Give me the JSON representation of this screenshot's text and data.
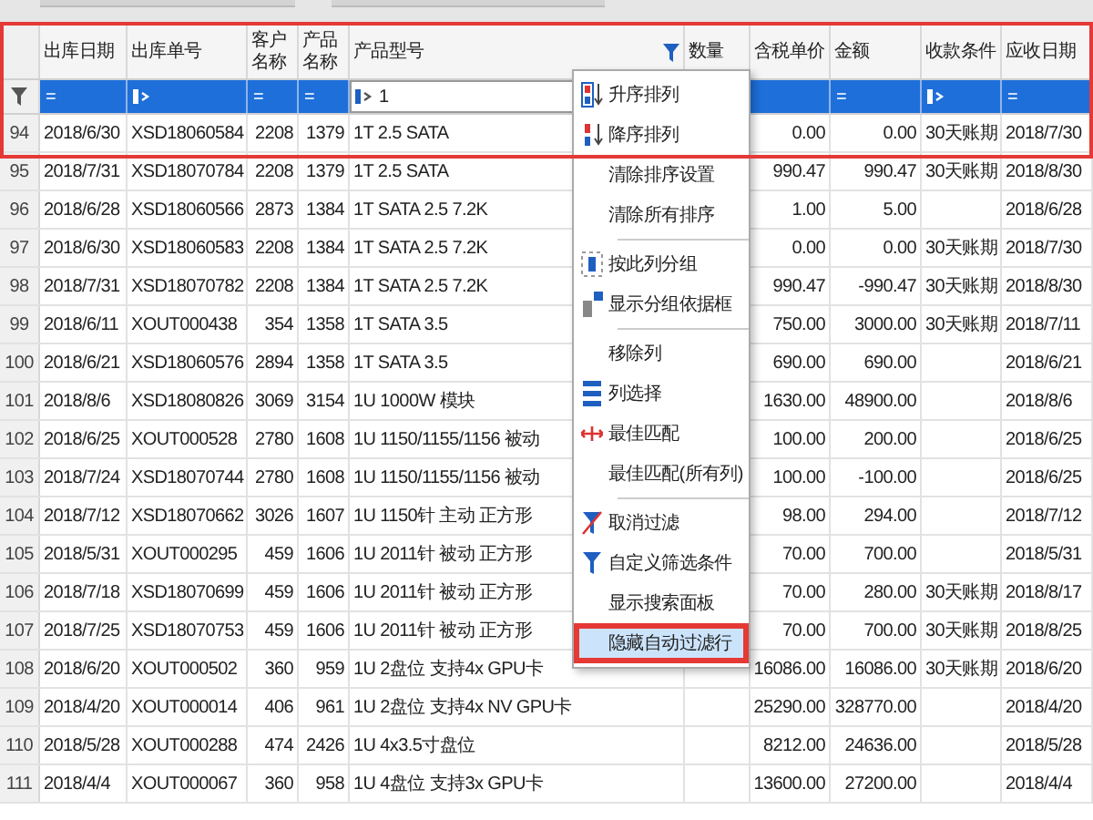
{
  "table": {
    "columns": [
      {
        "label": "出库日期"
      },
      {
        "label": "出库单号"
      },
      {
        "label": "客户名称"
      },
      {
        "label": "产品名称"
      },
      {
        "label": "产品型号",
        "filtered": true
      },
      {
        "label": "数量"
      },
      {
        "label": "含税单价"
      },
      {
        "label": "金额"
      },
      {
        "label": "收款条件"
      },
      {
        "label": "应收日期"
      }
    ],
    "filters": [
      {
        "kind": "equals",
        "text": "="
      },
      {
        "kind": "contains"
      },
      {
        "kind": "equals",
        "text": "="
      },
      {
        "kind": "equals",
        "text": "="
      },
      {
        "kind": "value",
        "value": "1"
      },
      {
        "kind": "blank"
      },
      {
        "kind": "blank"
      },
      {
        "kind": "equals",
        "text": "="
      },
      {
        "kind": "contains"
      },
      {
        "kind": "equals",
        "text": "="
      }
    ],
    "rows": [
      {
        "num": "94",
        "date": "2018/6/30",
        "order": "XSD18060584",
        "customer": "2208",
        "product": "1379",
        "model": "1T 2.5 SATA",
        "unit_price": "0.00",
        "amount": "0.00",
        "terms": "30天账期",
        "due": "2018/7/30"
      },
      {
        "num": "95",
        "date": "2018/7/31",
        "order": "XSD18070784",
        "customer": "2208",
        "product": "1379",
        "model": "1T 2.5 SATA",
        "unit_price": "990.47",
        "amount": "990.47",
        "terms": "30天账期",
        "due": "2018/8/30"
      },
      {
        "num": "96",
        "date": "2018/6/28",
        "order": "XSD18060566",
        "customer": "2873",
        "product": "1384",
        "model": "1T SATA 2.5 7.2K",
        "unit_price": "1.00",
        "amount": "5.00",
        "due": "2018/6/28"
      },
      {
        "num": "97",
        "date": "2018/6/30",
        "order": "XSD18060583",
        "customer": "2208",
        "product": "1384",
        "model": "1T SATA 2.5 7.2K",
        "unit_price": "0.00",
        "amount": "0.00",
        "terms": "30天账期",
        "due": "2018/7/30"
      },
      {
        "num": "98",
        "date": "2018/7/31",
        "order": "XSD18070782",
        "customer": "2208",
        "product": "1384",
        "model": "1T SATA 2.5 7.2K",
        "unit_price": "990.47",
        "amount": "-990.47",
        "terms": "30天账期",
        "due": "2018/8/30"
      },
      {
        "num": "99",
        "date": "2018/6/11",
        "order": "XOUT000438",
        "customer": "354",
        "product": "1358",
        "model": "1T SATA 3.5",
        "unit_price": "750.00",
        "amount": "3000.00",
        "terms": "30天账期",
        "due": "2018/7/11"
      },
      {
        "num": "100",
        "date": "2018/6/21",
        "order": "XSD18060576",
        "customer": "2894",
        "product": "1358",
        "model": "1T SATA 3.5",
        "unit_price": "690.00",
        "amount": "690.00",
        "due": "2018/6/21"
      },
      {
        "num": "101",
        "date": "2018/8/6",
        "order": "XSD18080826",
        "customer": "3069",
        "product": "3154",
        "model": "1U  1000W 模块",
        "unit_price": "1630.00",
        "amount": "48900.00",
        "due": "2018/8/6"
      },
      {
        "num": "102",
        "date": "2018/6/25",
        "order": "XOUT000528",
        "customer": "2780",
        "product": "1608",
        "model": "1U 1150/1155/1156 被动",
        "unit_price": "100.00",
        "amount": "200.00",
        "due": "2018/6/25"
      },
      {
        "num": "103",
        "date": "2018/7/24",
        "order": "XSD18070744",
        "customer": "2780",
        "product": "1608",
        "model": "1U 1150/1155/1156 被动",
        "unit_price": "100.00",
        "amount": "-100.00",
        "due": "2018/6/25"
      },
      {
        "num": "104",
        "date": "2018/7/12",
        "order": "XSD18070662",
        "customer": "3026",
        "product": "1607",
        "model": "1U 1150针 主动 正方形",
        "unit_price": "98.00",
        "amount": "294.00",
        "due": "2018/7/12"
      },
      {
        "num": "105",
        "date": "2018/5/31",
        "order": "XOUT000295",
        "customer": "459",
        "product": "1606",
        "model": "1U 2011针 被动 正方形",
        "unit_price": "70.00",
        "amount": "700.00",
        "due": "2018/5/31"
      },
      {
        "num": "106",
        "date": "2018/7/18",
        "order": "XSD18070699",
        "customer": "459",
        "product": "1606",
        "model": "1U 2011针 被动 正方形",
        "unit_price": "70.00",
        "amount": "280.00",
        "terms": "30天账期",
        "due": "2018/8/17"
      },
      {
        "num": "107",
        "date": "2018/7/25",
        "order": "XSD18070753",
        "customer": "459",
        "product": "1606",
        "model": "1U 2011针 被动 正方形",
        "unit_price": "70.00",
        "amount": "700.00",
        "terms": "30天账期",
        "due": "2018/8/25"
      },
      {
        "num": "108",
        "date": "2018/6/20",
        "order": "XOUT000502",
        "customer": "360",
        "product": "959",
        "model": "1U 2盘位  支持4x GPU卡",
        "unit_price": "16086.00",
        "amount": "16086.00",
        "terms": "30天账期",
        "due": "2018/6/20"
      },
      {
        "num": "109",
        "date": "2018/4/20",
        "order": "XOUT000014",
        "customer": "406",
        "product": "961",
        "model": "1U 2盘位  支持4x NV GPU卡",
        "unit_price": "25290.00",
        "amount": "328770.00",
        "due": "2018/4/20"
      },
      {
        "num": "110",
        "date": "2018/5/28",
        "order": "XOUT000288",
        "customer": "474",
        "product": "2426",
        "model": "1U 4x3.5寸盘位",
        "unit_price": "8212.00",
        "amount": "24636.00",
        "due": "2018/5/28"
      },
      {
        "num": "111",
        "date": "2018/4/4",
        "order": "XOUT000067",
        "customer": "360",
        "product": "958",
        "model": "1U 4盘位 支持3x GPU卡",
        "unit_price": "13600.00",
        "amount": "27200.00",
        "due": "2018/4/4"
      }
    ]
  },
  "context_menu": {
    "groups": [
      [
        {
          "label": "升序排列",
          "kind": "sort-asc",
          "selected": false
        },
        {
          "label": "降序排列",
          "kind": "sort-desc",
          "selected": false
        },
        {
          "label": "清除排序设置",
          "kind": "plain",
          "selected": false
        },
        {
          "label": "清除所有排序",
          "kind": "plain",
          "selected": false
        }
      ],
      [
        {
          "label": "按此列分组",
          "kind": "group",
          "selected": false
        },
        {
          "label": "显示分组依据框",
          "kind": "group-panel",
          "selected": false
        }
      ],
      [
        {
          "label": "移除列",
          "kind": "plain",
          "selected": false
        },
        {
          "label": "列选择",
          "kind": "columns",
          "selected": false
        },
        {
          "label": "最佳匹配",
          "kind": "best-fit",
          "selected": false
        },
        {
          "label": "最佳匹配(所有列)",
          "kind": "plain",
          "selected": false
        }
      ],
      [
        {
          "label": "取消过滤",
          "kind": "clear-filter",
          "selected": false
        },
        {
          "label": "自定义筛选条件",
          "kind": "custom-filter",
          "selected": false
        },
        {
          "label": "显示搜索面板",
          "kind": "plain",
          "selected": false
        },
        {
          "label": "隐藏自动过滤行",
          "kind": "plain",
          "selected": true
        }
      ]
    ]
  }
}
